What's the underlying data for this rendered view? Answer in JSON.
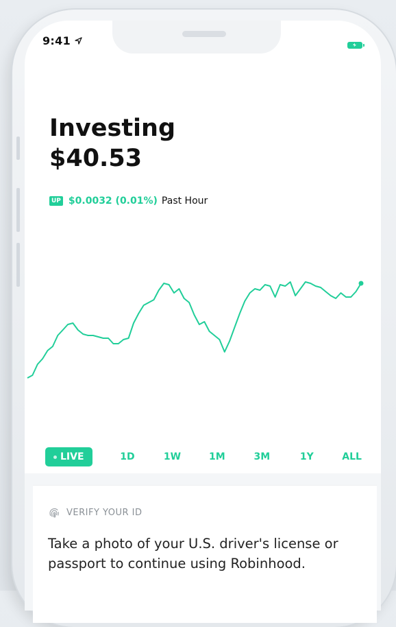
{
  "status_bar": {
    "time": "9:41"
  },
  "header": {
    "title": "Investing",
    "balance": "$40.53"
  },
  "change": {
    "badge": "UP",
    "value": "$0.0032 (0.01%)",
    "period": "Past Hour"
  },
  "colors": {
    "accent": "#21ce99",
    "text": "#111111",
    "muted": "#8a9096"
  },
  "chart_data": {
    "type": "line",
    "series": [
      {
        "values": [
          17,
          19,
          27,
          31,
          37,
          40,
          48,
          52,
          56,
          57,
          52,
          49,
          48,
          48,
          47,
          46,
          46,
          42,
          42,
          45,
          46,
          57,
          64,
          70,
          72,
          74,
          81,
          86,
          85,
          79,
          82,
          75,
          72,
          63,
          56,
          58,
          51,
          48,
          45,
          36,
          44,
          54,
          64,
          73,
          79,
          82,
          81,
          85,
          84,
          76,
          85,
          84,
          87,
          77,
          82,
          87,
          86,
          84,
          83,
          80,
          77,
          75,
          79,
          76,
          76,
          80,
          86
        ]
      }
    ]
  },
  "time_ranges": [
    {
      "label": "LIVE",
      "active": true
    },
    {
      "label": "1D",
      "active": false
    },
    {
      "label": "1W",
      "active": false
    },
    {
      "label": "1M",
      "active": false
    },
    {
      "label": "3M",
      "active": false
    },
    {
      "label": "1Y",
      "active": false
    },
    {
      "label": "ALL",
      "active": false
    }
  ],
  "card": {
    "icon": "fingerprint-icon",
    "heading": "VERIFY YOUR ID",
    "body": "Take a photo of your U.S. driver's license or passport to continue using Robinhood."
  }
}
